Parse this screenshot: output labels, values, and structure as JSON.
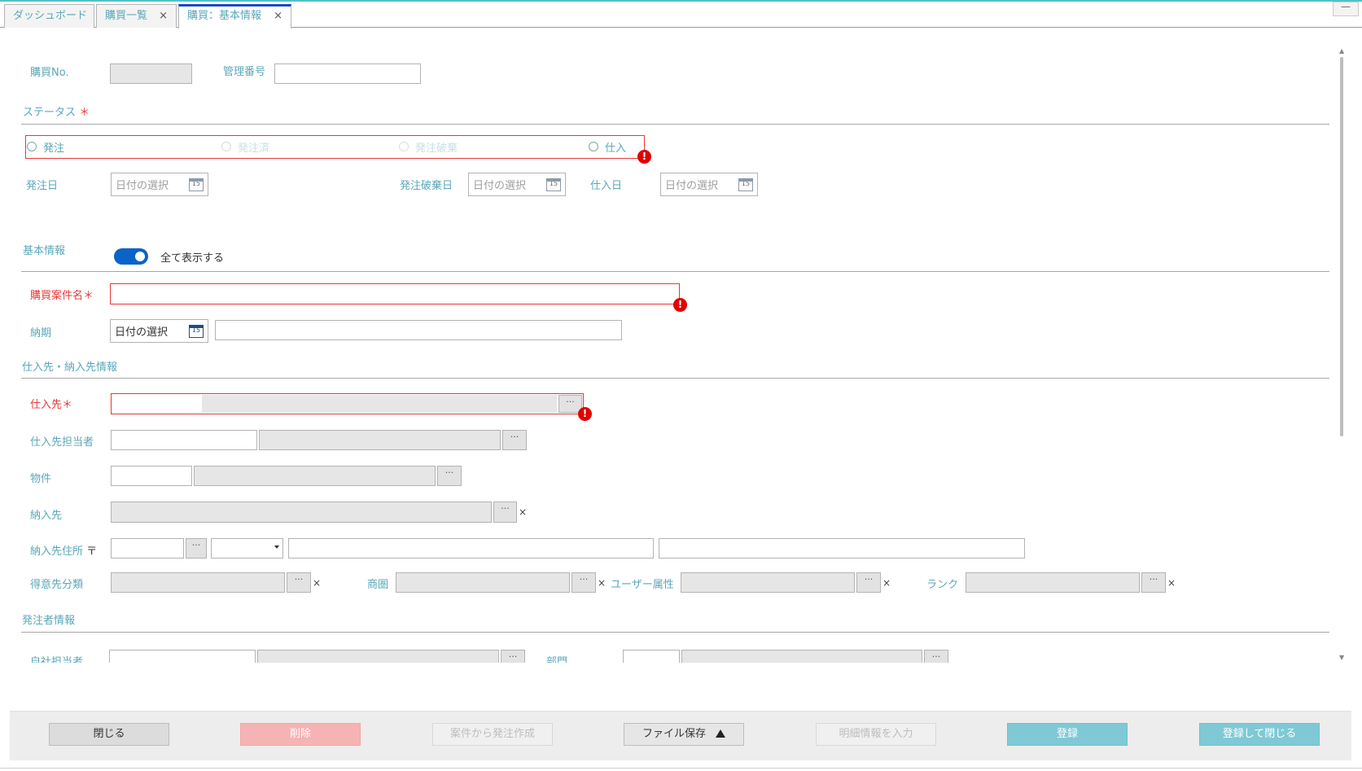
{
  "tabs": [
    {
      "label": "ダッシュボード",
      "closable": false
    },
    {
      "label": "購買一覧",
      "closable": true
    },
    {
      "label": "購買：基本情報",
      "closable": true,
      "active": true
    }
  ],
  "window": {
    "minimize": "—"
  },
  "header": {
    "purchase_no_label": "購買No.",
    "purchase_no_value": "",
    "control_no_label": "管理番号",
    "control_no_value": ""
  },
  "status": {
    "label": "ステータス",
    "required_mark": "＊",
    "options": [
      {
        "label": "発注",
        "enabled": true,
        "checked": false
      },
      {
        "label": "発注済",
        "enabled": false,
        "checked": false
      },
      {
        "label": "発注破棄",
        "enabled": false,
        "checked": false
      },
      {
        "label": "仕入",
        "enabled": true,
        "checked": false
      }
    ],
    "error_mark": "!"
  },
  "dates": {
    "order_date_label": "発注日",
    "order_cancel_date_label": "発注破棄日",
    "purchase_date_label": "仕入日",
    "placeholder": "日付の選択",
    "calendar_day": "15"
  },
  "basic": {
    "section_label": "基本情報",
    "toggle_label": "全て表示する",
    "toggle_on": true,
    "project_name_label": "購買案件名",
    "required_mark": "＊",
    "project_name_value": "",
    "due_label": "納期",
    "due_placeholder": "日付の選択",
    "due_note_value": ""
  },
  "supplier": {
    "section_label": "仕入先・納入先情報",
    "supplier_label": "仕入先",
    "required_mark": "＊",
    "supplier_contact_label": "仕入先担当者",
    "property_label": "物件",
    "delivery_label": "納入先",
    "delivery_address_label": "納入先住所",
    "postal_mark": "〒",
    "customer_class_label": "得意先分類",
    "trade_area_label": "商圏",
    "user_attr_label": "ユーザー属性",
    "rank_label": "ランク",
    "dots": "···",
    "clear": "×"
  },
  "orderer": {
    "section_label": "発注者情報",
    "own_staff_label": "自社担当者",
    "department_label": "部門"
  },
  "footer": {
    "close": "閉じる",
    "delete": "削除",
    "create_order": "案件から発注作成",
    "file_save": "ファイル保存",
    "enter_details": "明細情報を入力",
    "register": "登録",
    "register_close": "登録して閉じる"
  }
}
